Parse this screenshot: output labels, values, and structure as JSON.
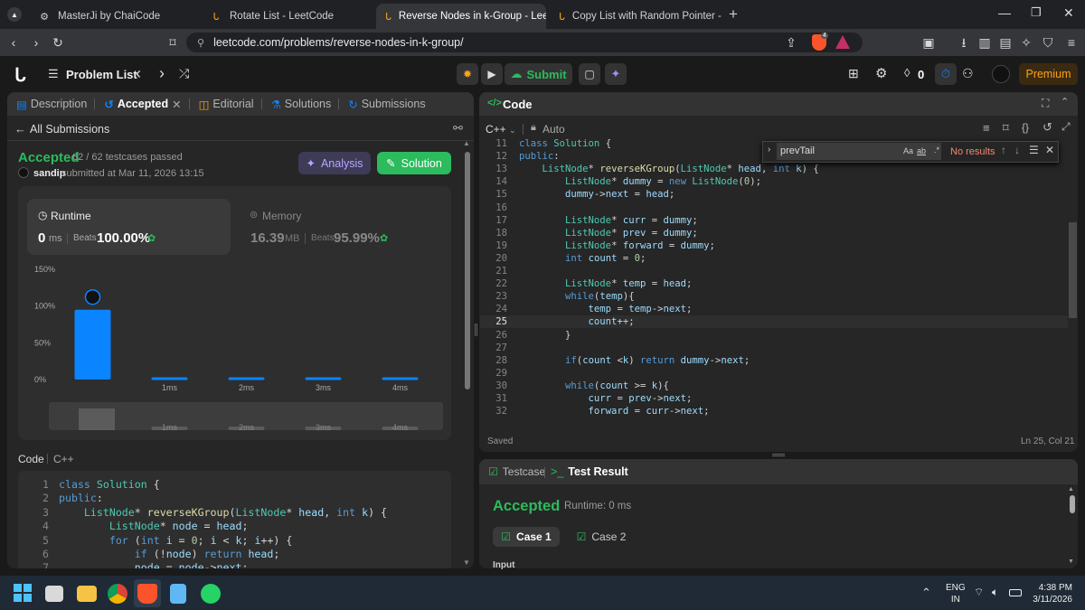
{
  "browser": {
    "tabs": [
      {
        "title": "MasterJi by ChaiCode"
      },
      {
        "title": "Rotate List - LeetCode"
      },
      {
        "title": "Reverse Nodes in k-Group - Leet"
      },
      {
        "title": "Copy List with Random Pointer - Leet"
      }
    ],
    "url": "leetcode.com/problems/reverse-nodes-in-k-group/",
    "brave_badge": "4"
  },
  "nav": {
    "problem_list": "Problem List",
    "submit": "Submit",
    "streak": "0",
    "premium": "Premium"
  },
  "left": {
    "tabs": [
      "Description",
      "Accepted",
      "Editorial",
      "Solutions",
      "Submissions"
    ],
    "all_submissions": "All Submissions",
    "status": "Accepted",
    "testcases": "62 / 62 testcases passed",
    "user": "sandip",
    "submitted": "submitted at Mar 11, 2026 13:15",
    "analysis": "Analysis",
    "solution": "Solution",
    "runtime_label": "Runtime",
    "runtime_value": "0",
    "runtime_unit": "ms",
    "runtime_beats_label": "Beats",
    "runtime_beats": "100.00%",
    "memory_label": "Memory",
    "memory_value": "16.39",
    "memory_unit": "MB",
    "memory_beats_label": "Beats",
    "memory_beats": "95.99%",
    "code_label": "Code",
    "lang": "C++"
  },
  "chart_data": {
    "type": "bar",
    "categories": [
      "0ms",
      "1ms",
      "2ms",
      "3ms",
      "4ms"
    ],
    "values": [
      95,
      3,
      3,
      3,
      3
    ],
    "ylim": [
      0,
      150
    ],
    "yticks": [
      "150%",
      "100%",
      "50%",
      "0%"
    ],
    "xlabels": [
      "",
      "1ms",
      "2ms",
      "3ms",
      "4ms"
    ],
    "accent": "#0a84ff"
  },
  "left_code": [
    {
      "n": "1",
      "t": "class Solution {"
    },
    {
      "n": "2",
      "t": "public:"
    },
    {
      "n": "3",
      "t": "    ListNode* reverseKGroup(ListNode* head, int k) {"
    },
    {
      "n": "4",
      "t": "        ListNode* node = head;"
    },
    {
      "n": "5",
      "t": "        for (int i = 0; i < k; i++) {"
    },
    {
      "n": "6",
      "t": "            if (!node) return head;"
    },
    {
      "n": "7",
      "t": "            node = node->next;"
    }
  ],
  "editor": {
    "title": "Code",
    "lang": "C++",
    "mode": "Auto",
    "find": "prevTail",
    "find_opts": [
      "Aa",
      "ab",
      ".*"
    ],
    "no_results": "No results",
    "saved": "Saved",
    "cursor": "Ln 25, Col 21",
    "lines": [
      {
        "n": "11",
        "t": "class Solution {"
      },
      {
        "n": "12",
        "t": "public:"
      },
      {
        "n": "13",
        "t": "    ListNode* reverseKGroup(ListNode* head, int k) {"
      },
      {
        "n": "14",
        "t": "        ListNode* dummy = new ListNode(0);"
      },
      {
        "n": "15",
        "t": "        dummy->next = head;"
      },
      {
        "n": "16",
        "t": ""
      },
      {
        "n": "17",
        "t": "        ListNode* curr = dummy;"
      },
      {
        "n": "18",
        "t": "        ListNode* prev = dummy;"
      },
      {
        "n": "19",
        "t": "        ListNode* forward = dummy;"
      },
      {
        "n": "20",
        "t": "        int count = 0;"
      },
      {
        "n": "21",
        "t": ""
      },
      {
        "n": "22",
        "t": "        ListNode* temp = head;"
      },
      {
        "n": "23",
        "t": "        while(temp){"
      },
      {
        "n": "24",
        "t": "            temp = temp->next;"
      },
      {
        "n": "25",
        "t": "            count++;"
      },
      {
        "n": "26",
        "t": "        }"
      },
      {
        "n": "27",
        "t": ""
      },
      {
        "n": "28",
        "t": "        if(count <k) return dummy->next;"
      },
      {
        "n": "29",
        "t": ""
      },
      {
        "n": "30",
        "t": "        while(count >= k){"
      },
      {
        "n": "31",
        "t": "            curr = prev->next;"
      },
      {
        "n": "32",
        "t": "            forward = curr->next;"
      }
    ]
  },
  "test": {
    "testcase": "Testcase",
    "result": "Test Result",
    "status": "Accepted",
    "runtime": "Runtime: 0 ms",
    "case1": "Case 1",
    "case2": "Case 2",
    "input": "Input"
  },
  "taskbar": {
    "lang1": "ENG",
    "lang2": "IN",
    "time": "4:38 PM",
    "date": "3/11/2026"
  }
}
